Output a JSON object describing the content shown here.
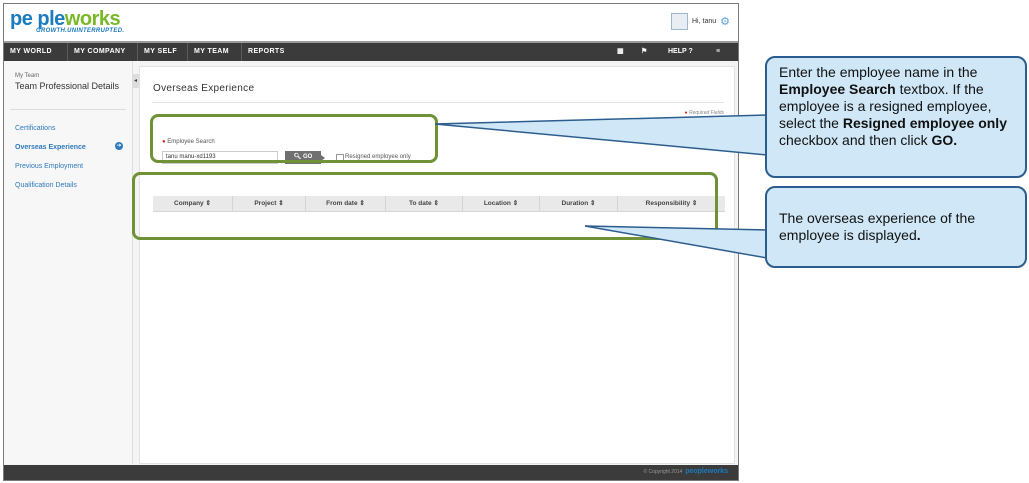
{
  "header": {
    "logo_people": "pe ple",
    "logo_works": "works",
    "tagline": "GROWTH.UNINTERRUPTED.",
    "greeting": "Hi, tanu"
  },
  "nav": {
    "items": [
      "MY WORLD",
      "MY COMPANY",
      "MY SELF",
      "MY TEAM",
      "REPORTS"
    ],
    "help": "HELP"
  },
  "sidebar": {
    "subtitle": "My Team",
    "title": "Team Professional Details",
    "links": [
      "Certifications",
      "Overseas Experience",
      "Previous Employment",
      "Qualification Details"
    ],
    "active_index": 1
  },
  "main": {
    "title": "Overseas Experience",
    "required_note": "Required Fields",
    "search_label": "Employee Search",
    "search_value": "tanu manu-xd1193",
    "go_label": "GO",
    "resigned_label": "Resigned employee only",
    "columns": [
      "Company",
      "Project",
      "From date",
      "To date",
      "Location",
      "Duration",
      "Responsibility"
    ]
  },
  "footer": {
    "copyright": "© Copyright 2014",
    "brand": "peopleworks"
  },
  "callouts": {
    "search": {
      "p1": "Enter the employee name in the ",
      "b1": "Employee Search",
      "p2": " textbox.  If the employee is a resigned employee, select the ",
      "b2": "Resigned employee only",
      "p3": " checkbox and then click ",
      "b3": "GO."
    },
    "table": {
      "p1": "The overseas experience of the employee is displayed",
      "b1": "."
    }
  },
  "colors": {
    "brand_blue": "#1a7bbf",
    "brand_green": "#7ab828",
    "nav_bg": "#3b3b3b",
    "highlight_border": "#6e9235",
    "callout_fill": "#cfe7f6",
    "callout_border": "#2d5d8f"
  }
}
